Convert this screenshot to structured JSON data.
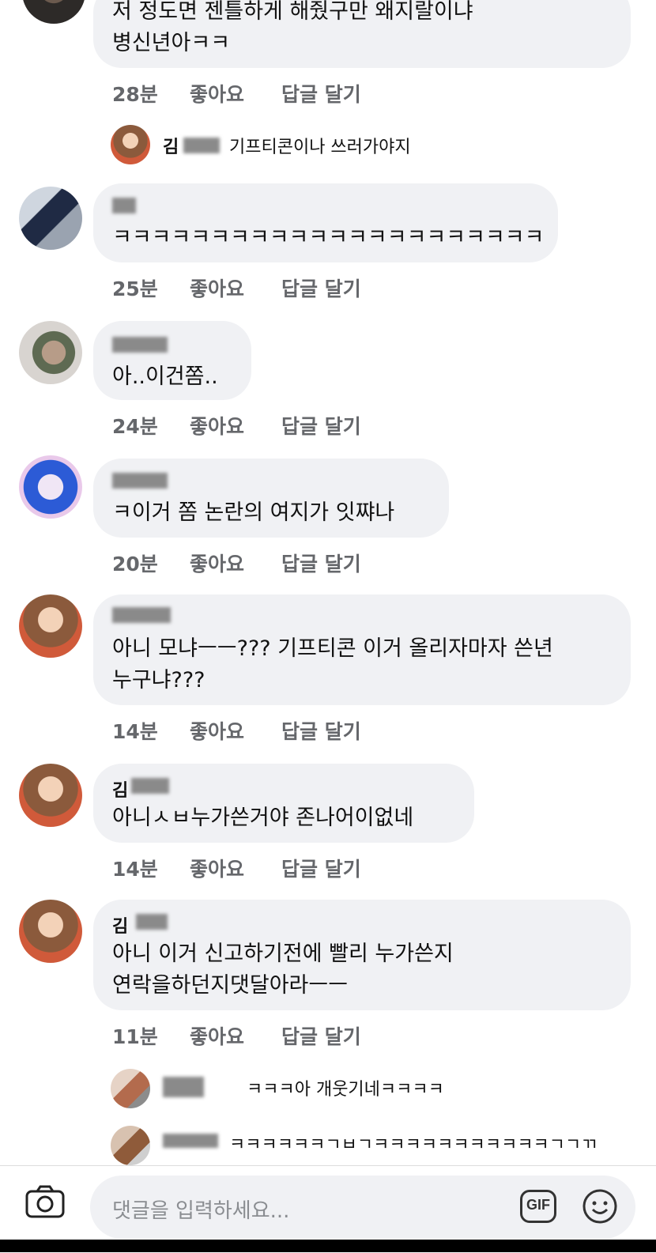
{
  "comments": [
    {
      "id": "c1",
      "name": "",
      "lines": [
        "저 정도면 젠틀하게 해줬구만 왜지랄이냐",
        "병신년아ㅋㅋ"
      ],
      "time": "28분",
      "like": "좋아요",
      "reply": "답글 달기"
    },
    {
      "id": "c2",
      "name": "",
      "lines": [
        "ㅋㅋㅋㅋㅋㅋㅋㅋㅋㅋㅋㅋㅋㅋㅋㅋㅋㅋㅋㅋㅋㅋ"
      ],
      "time": "25분",
      "like": "좋아요",
      "reply": "답글 달기"
    },
    {
      "id": "c3",
      "name": "",
      "lines": [
        "아..이건쫌.."
      ],
      "time": "24분",
      "like": "좋아요",
      "reply": "답글 달기"
    },
    {
      "id": "c4",
      "name": "",
      "lines": [
        "ㅋ이거 쫌 논란의 여지가 잇쨔나"
      ],
      "time": "20분",
      "like": "좋아요",
      "reply": "답글 달기"
    },
    {
      "id": "c5",
      "name": "",
      "lines": [
        "아니 모냐ㅡㅡ??? 기프티콘 이거 올리자마자 쓴년",
        "누구냐???"
      ],
      "time": "14분",
      "like": "좋아요",
      "reply": "답글 달기"
    },
    {
      "id": "c6",
      "name": "김",
      "lines": [
        "아니ㅅㅂ누가쓴거야 존나어이없네"
      ],
      "time": "14분",
      "like": "좋아요",
      "reply": "답글 달기"
    },
    {
      "id": "c7",
      "name": "김",
      "lines": [
        "아니 이거 신고하기전에 빨리 누가쓴지",
        "연락을하던지댓달아라ㅡㅡ"
      ],
      "time": "11분",
      "like": "좋아요",
      "reply": "답글 달기"
    }
  ],
  "replies": [
    {
      "id": "r1",
      "name": "김",
      "text": "기프티콘이나 쓰러가야지"
    },
    {
      "id": "r2",
      "name": "",
      "text": "ㅋㅋㅋ아 개웃기네ㅋㅋㅋㅋ"
    },
    {
      "id": "r3",
      "name": "",
      "text": "ㅋㅋㅋㅋㅋㅋㄱㅂㄱㅋㅋㅋㅋㅋㅋㅋㅋㅋㅋㅋㄱㄱㄲ"
    }
  ],
  "composer": {
    "placeholder": "댓글을 입력하세요...",
    "gif_label": "GIF",
    "camera_icon": "camera-icon",
    "emoji_icon": "smiley-icon"
  }
}
